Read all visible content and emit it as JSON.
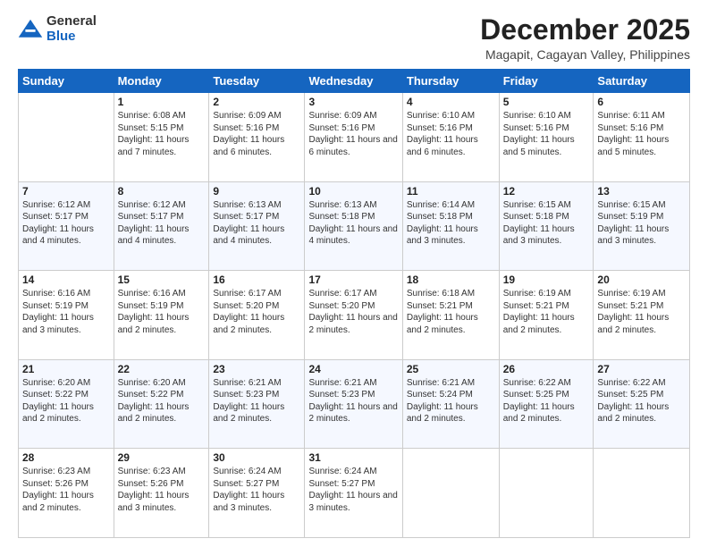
{
  "header": {
    "logo": {
      "general": "General",
      "blue": "Blue"
    },
    "month": "December 2025",
    "location": "Magapit, Cagayan Valley, Philippines"
  },
  "weekdays": [
    "Sunday",
    "Monday",
    "Tuesday",
    "Wednesday",
    "Thursday",
    "Friday",
    "Saturday"
  ],
  "weeks": [
    [
      {
        "day": null
      },
      {
        "day": "1",
        "sunrise": "6:08 AM",
        "sunset": "5:15 PM",
        "daylight": "11 hours and 7 minutes."
      },
      {
        "day": "2",
        "sunrise": "6:09 AM",
        "sunset": "5:16 PM",
        "daylight": "11 hours and 6 minutes."
      },
      {
        "day": "3",
        "sunrise": "6:09 AM",
        "sunset": "5:16 PM",
        "daylight": "11 hours and 6 minutes."
      },
      {
        "day": "4",
        "sunrise": "6:10 AM",
        "sunset": "5:16 PM",
        "daylight": "11 hours and 6 minutes."
      },
      {
        "day": "5",
        "sunrise": "6:10 AM",
        "sunset": "5:16 PM",
        "daylight": "11 hours and 5 minutes."
      },
      {
        "day": "6",
        "sunrise": "6:11 AM",
        "sunset": "5:16 PM",
        "daylight": "11 hours and 5 minutes."
      }
    ],
    [
      {
        "day": "7",
        "sunrise": "6:12 AM",
        "sunset": "5:17 PM",
        "daylight": "11 hours and 4 minutes."
      },
      {
        "day": "8",
        "sunrise": "6:12 AM",
        "sunset": "5:17 PM",
        "daylight": "11 hours and 4 minutes."
      },
      {
        "day": "9",
        "sunrise": "6:13 AM",
        "sunset": "5:17 PM",
        "daylight": "11 hours and 4 minutes."
      },
      {
        "day": "10",
        "sunrise": "6:13 AM",
        "sunset": "5:18 PM",
        "daylight": "11 hours and 4 minutes."
      },
      {
        "day": "11",
        "sunrise": "6:14 AM",
        "sunset": "5:18 PM",
        "daylight": "11 hours and 3 minutes."
      },
      {
        "day": "12",
        "sunrise": "6:15 AM",
        "sunset": "5:18 PM",
        "daylight": "11 hours and 3 minutes."
      },
      {
        "day": "13",
        "sunrise": "6:15 AM",
        "sunset": "5:19 PM",
        "daylight": "11 hours and 3 minutes."
      }
    ],
    [
      {
        "day": "14",
        "sunrise": "6:16 AM",
        "sunset": "5:19 PM",
        "daylight": "11 hours and 3 minutes."
      },
      {
        "day": "15",
        "sunrise": "6:16 AM",
        "sunset": "5:19 PM",
        "daylight": "11 hours and 2 minutes."
      },
      {
        "day": "16",
        "sunrise": "6:17 AM",
        "sunset": "5:20 PM",
        "daylight": "11 hours and 2 minutes."
      },
      {
        "day": "17",
        "sunrise": "6:17 AM",
        "sunset": "5:20 PM",
        "daylight": "11 hours and 2 minutes."
      },
      {
        "day": "18",
        "sunrise": "6:18 AM",
        "sunset": "5:21 PM",
        "daylight": "11 hours and 2 minutes."
      },
      {
        "day": "19",
        "sunrise": "6:19 AM",
        "sunset": "5:21 PM",
        "daylight": "11 hours and 2 minutes."
      },
      {
        "day": "20",
        "sunrise": "6:19 AM",
        "sunset": "5:21 PM",
        "daylight": "11 hours and 2 minutes."
      }
    ],
    [
      {
        "day": "21",
        "sunrise": "6:20 AM",
        "sunset": "5:22 PM",
        "daylight": "11 hours and 2 minutes."
      },
      {
        "day": "22",
        "sunrise": "6:20 AM",
        "sunset": "5:22 PM",
        "daylight": "11 hours and 2 minutes."
      },
      {
        "day": "23",
        "sunrise": "6:21 AM",
        "sunset": "5:23 PM",
        "daylight": "11 hours and 2 minutes."
      },
      {
        "day": "24",
        "sunrise": "6:21 AM",
        "sunset": "5:23 PM",
        "daylight": "11 hours and 2 minutes."
      },
      {
        "day": "25",
        "sunrise": "6:21 AM",
        "sunset": "5:24 PM",
        "daylight": "11 hours and 2 minutes."
      },
      {
        "day": "26",
        "sunrise": "6:22 AM",
        "sunset": "5:25 PM",
        "daylight": "11 hours and 2 minutes."
      },
      {
        "day": "27",
        "sunrise": "6:22 AM",
        "sunset": "5:25 PM",
        "daylight": "11 hours and 2 minutes."
      }
    ],
    [
      {
        "day": "28",
        "sunrise": "6:23 AM",
        "sunset": "5:26 PM",
        "daylight": "11 hours and 2 minutes."
      },
      {
        "day": "29",
        "sunrise": "6:23 AM",
        "sunset": "5:26 PM",
        "daylight": "11 hours and 3 minutes."
      },
      {
        "day": "30",
        "sunrise": "6:24 AM",
        "sunset": "5:27 PM",
        "daylight": "11 hours and 3 minutes."
      },
      {
        "day": "31",
        "sunrise": "6:24 AM",
        "sunset": "5:27 PM",
        "daylight": "11 hours and 3 minutes."
      },
      {
        "day": null
      },
      {
        "day": null
      },
      {
        "day": null
      }
    ]
  ]
}
